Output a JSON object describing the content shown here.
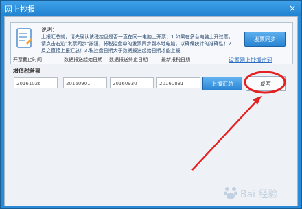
{
  "window": {
    "title": "网上抄报",
    "close_glyph": "×"
  },
  "note": {
    "title": "说明：",
    "text": "上报汇总前，请先确认该税控盘是否一直在同一电脑上开票；1.如果在多台电脑上开过票，请点击右边\"发票同步\"按钮，将税控盘中的发票同步到本地电脑，以确保统计的准确性！2.反之直接上报汇总！3.税控盘日期大于数据报送起始日期才能上报",
    "sync_button": "发票同步"
  },
  "headers": {
    "col1": "开票截止时间",
    "col2": "数据报送起始日期",
    "col3": "数据报送终止日期",
    "col4": "最新报税日期"
  },
  "section_label": "增值税普票",
  "setting_link": "设置网上抄报密码",
  "fields": {
    "value1": "20161026",
    "value2": "20160901",
    "value3": "20160930",
    "value4": "20160831"
  },
  "buttons": {
    "upload": "上报汇总",
    "writeback": "反写"
  },
  "watermark": {
    "text": "Bai 经验"
  },
  "colors": {
    "annotation": "#e52121",
    "accent": "#2a84d2"
  }
}
